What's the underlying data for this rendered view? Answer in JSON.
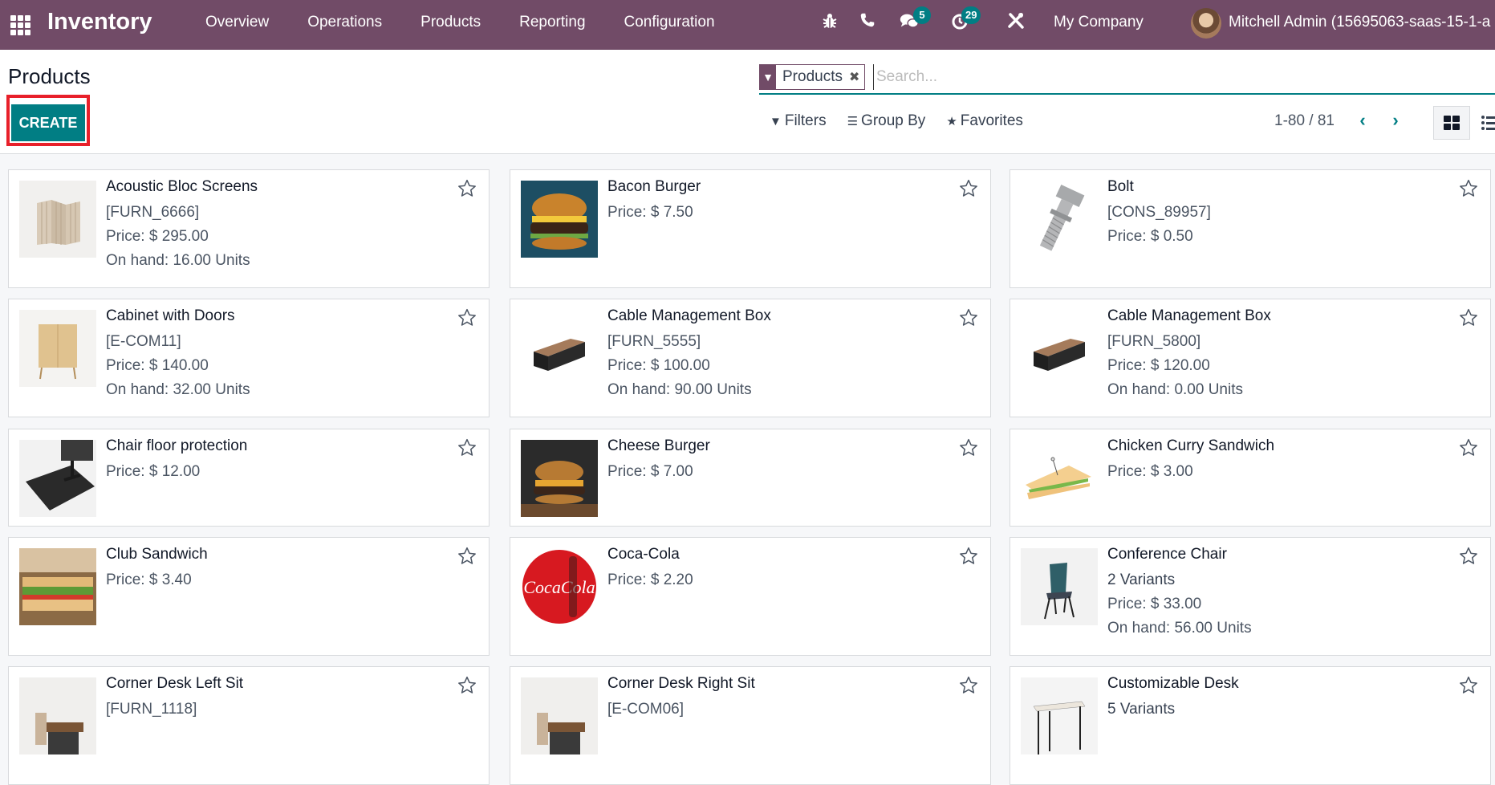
{
  "navbar": {
    "app_name": "Inventory",
    "menu": [
      "Overview",
      "Operations",
      "Products",
      "Reporting",
      "Configuration"
    ],
    "messages_count": "5",
    "activities_count": "29",
    "company": "My Company",
    "user": "Mitchell Admin (15695063-saas-15-1-a"
  },
  "control_panel": {
    "title": "Products",
    "create_label": "CREATE",
    "facet_label": "Products",
    "search_placeholder": "Search...",
    "filters_label": "Filters",
    "groupby_label": "Group By",
    "favorites_label": "Favorites",
    "pager": "1-80 / 81"
  },
  "products": [
    {
      "name": "Acoustic Bloc Screens",
      "ref": "[FURN_6666]",
      "price": "Price: $ 295.00",
      "onhand": "On hand: 16.00 Units",
      "img": "screens"
    },
    {
      "name": "Bacon Burger",
      "price": "Price: $ 7.50",
      "img": "burger"
    },
    {
      "name": "Bolt",
      "ref": "[CONS_89957]",
      "price": "Price: $ 0.50",
      "img": "bolt"
    },
    {
      "name": "Cabinet with Doors",
      "ref": "[E-COM11]",
      "price": "Price: $ 140.00",
      "onhand": "On hand: 32.00 Units",
      "img": "cabinet"
    },
    {
      "name": "Cable Management Box",
      "ref": "[FURN_5555]",
      "price": "Price: $ 100.00",
      "onhand": "On hand: 90.00 Units",
      "img": "box"
    },
    {
      "name": "Cable Management Box",
      "ref": "[FURN_5800]",
      "price": "Price: $ 120.00",
      "onhand": "On hand: 0.00 Units",
      "img": "box"
    },
    {
      "name": "Chair floor protection",
      "price": "Price: $ 12.00",
      "img": "mat"
    },
    {
      "name": "Cheese Burger",
      "price": "Price: $ 7.00",
      "img": "burger2"
    },
    {
      "name": "Chicken Curry Sandwich",
      "price": "Price: $ 3.00",
      "img": "sandwich"
    },
    {
      "name": "Club Sandwich",
      "price": "Price: $ 3.40",
      "img": "club"
    },
    {
      "name": "Coca-Cola",
      "price": "Price: $ 2.20",
      "img": "coke"
    },
    {
      "name": "Conference Chair",
      "variants": "2 Variants",
      "price": "Price: $ 33.00",
      "onhand": "On hand: 56.00 Units",
      "img": "chair"
    },
    {
      "name": "Corner Desk Left Sit",
      "ref": "[FURN_1118]",
      "img": "desk"
    },
    {
      "name": "Corner Desk Right Sit",
      "ref": "[E-COM06]",
      "img": "desk"
    },
    {
      "name": "Customizable Desk",
      "variants": "5 Variants",
      "img": "table"
    }
  ],
  "colors": {
    "navbar": "#714B67",
    "primary": "#017e84",
    "highlight_outline": "#e8202a"
  }
}
